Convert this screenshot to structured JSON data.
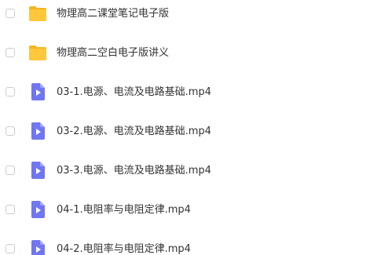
{
  "files": [
    {
      "name": "物理高二课堂笔记电子版",
      "type": "folder",
      "icon": "folder-icon"
    },
    {
      "name": "物理高二空白电子版讲义",
      "type": "folder",
      "icon": "folder-icon"
    },
    {
      "name": "03-1.电源、电流及电路基础.mp4",
      "type": "video",
      "icon": "video-file-icon"
    },
    {
      "name": "03-2.电源、电流及电路基础.mp4",
      "type": "video",
      "icon": "video-file-icon"
    },
    {
      "name": "03-3.电源、电流及电路基础.mp4",
      "type": "video",
      "icon": "video-file-icon"
    },
    {
      "name": "04-1.电阻率与电阻定律.mp4",
      "type": "video",
      "icon": "video-file-icon"
    },
    {
      "name": "04-2.电阻率与电阻定律.mp4",
      "type": "video",
      "icon": "video-file-icon"
    }
  ],
  "colors": {
    "folder": "#ffc73b",
    "folder_tab": "#f5b521",
    "video": "#7176f2",
    "checkbox_border": "#c9cdd4",
    "text": "#333333"
  }
}
